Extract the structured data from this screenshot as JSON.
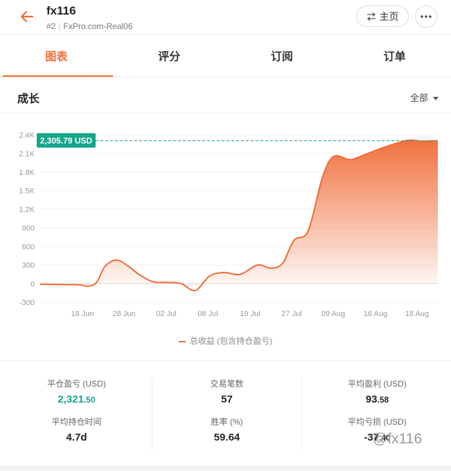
{
  "header": {
    "title": "fx116",
    "rank": "#2",
    "server": "FxPro.com-Real06",
    "home_label": "主页"
  },
  "tabs": [
    {
      "label": "图表",
      "active": true
    },
    {
      "label": "评分",
      "active": false
    },
    {
      "label": "订阅",
      "active": false
    },
    {
      "label": "订单",
      "active": false
    }
  ],
  "section": {
    "title": "成长",
    "range_label": "全部"
  },
  "chart_data": {
    "type": "area",
    "title": "",
    "xlabel": "",
    "ylabel": "",
    "ylim": [
      -300,
      2400
    ],
    "y_ticks": [
      "2.4K",
      "2.1K",
      "1.8K",
      "1.5K",
      "1.2K",
      "900",
      "600",
      "300",
      "0",
      "-300"
    ],
    "x_ticks": [
      "18 Jun",
      "28 Jun",
      "02 Jul",
      "08 Jul",
      "19 Jul",
      "27 Jul",
      "09 Aug",
      "16 Aug",
      "18 Aug"
    ],
    "current_label": "2,305.79 USD",
    "current_value": 2305.79,
    "colors": {
      "line": "#f06a35",
      "marker": "#17a589"
    },
    "series": [
      {
        "name": "总收益 (包含持仓盈亏)",
        "points": [
          [
            0,
            -10
          ],
          [
            0.4,
            -15
          ],
          [
            0.7,
            -20
          ],
          [
            0.85,
            -40
          ],
          [
            1.0,
            20
          ],
          [
            1.15,
            280
          ],
          [
            1.35,
            380
          ],
          [
            1.55,
            290
          ],
          [
            1.75,
            150
          ],
          [
            2.0,
            30
          ],
          [
            2.25,
            20
          ],
          [
            2.5,
            0
          ],
          [
            2.75,
            -110
          ],
          [
            3.0,
            120
          ],
          [
            3.25,
            180
          ],
          [
            3.55,
            150
          ],
          [
            3.85,
            300
          ],
          [
            4.1,
            250
          ],
          [
            4.3,
            330
          ],
          [
            4.5,
            700
          ],
          [
            4.75,
            850
          ],
          [
            5.0,
            1700
          ],
          [
            5.2,
            2050
          ],
          [
            5.5,
            2000
          ],
          [
            5.75,
            2080
          ],
          [
            6.1,
            2200
          ],
          [
            6.5,
            2310
          ],
          [
            6.75,
            2300
          ],
          [
            7.05,
            2305.79
          ]
        ]
      }
    ]
  },
  "legend": {
    "label": "总收益 (包含持仓盈亏)"
  },
  "stats": [
    {
      "label": "平仓盈亏 (USD)",
      "int": "2,321",
      "dec": ".50",
      "green": true
    },
    {
      "label": "交易笔数",
      "int": "57",
      "dec": "",
      "green": false
    },
    {
      "label": "平均盈利 (USD)",
      "int": "93",
      "dec": ".58",
      "green": false
    },
    {
      "label": "平均持仓时间",
      "int": "4.7d",
      "dec": "",
      "green": false
    },
    {
      "label": "胜率 (%)",
      "int": "59.64",
      "dec": "",
      "green": false
    },
    {
      "label": "平均亏损 (USD)",
      "int": "-37",
      "dec": ".40",
      "green": false
    }
  ],
  "watermark": "@fx116"
}
